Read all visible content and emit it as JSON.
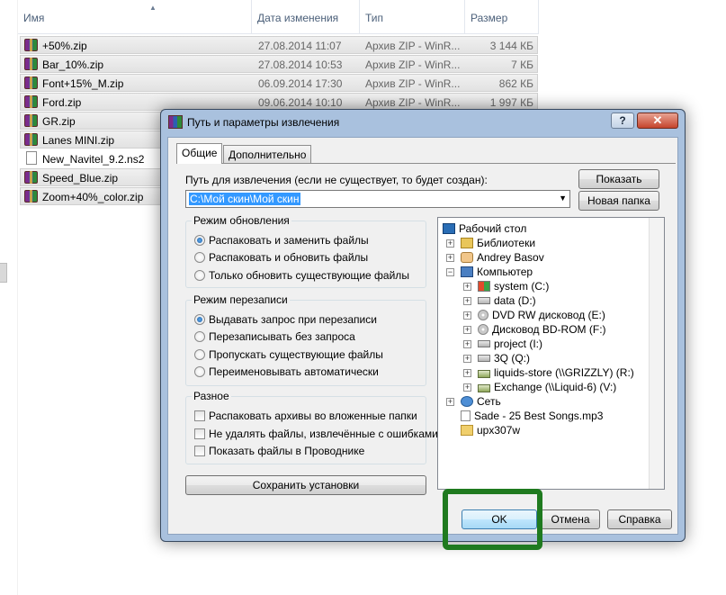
{
  "explorer": {
    "columns": {
      "name": "Имя",
      "date": "Дата изменения",
      "type": "Тип",
      "size": "Размер"
    },
    "files": [
      {
        "name": "+50%.zip",
        "date": "27.08.2014 11:07",
        "type": "Архив ZIP - WinR...",
        "size": "3 144 КБ",
        "icon": "rar-archive-icon",
        "selected": true
      },
      {
        "name": "Bar_10%.zip",
        "date": "27.08.2014 10:53",
        "type": "Архив ZIP - WinR...",
        "size": "7 КБ",
        "icon": "rar-archive-icon",
        "selected": true
      },
      {
        "name": "Font+15%_M.zip",
        "date": "06.09.2014 17:30",
        "type": "Архив ZIP - WinR...",
        "size": "862 КБ",
        "icon": "rar-archive-icon",
        "selected": true
      },
      {
        "name": "Ford.zip",
        "date": "09.06.2014 10:10",
        "type": "Архив ZIP - WinR...",
        "size": "1 997 КБ",
        "icon": "rar-archive-icon",
        "selected": true
      },
      {
        "name": "GR.zip",
        "date": "",
        "type": "",
        "size": "",
        "icon": "rar-archive-icon",
        "selected": true
      },
      {
        "name": "Lanes MINI.zip",
        "date": "",
        "type": "",
        "size": "",
        "icon": "rar-archive-icon",
        "selected": true
      },
      {
        "name": "New_Navitel_9.2.ns2",
        "date": "",
        "type": "",
        "size": "",
        "icon": "document-icon",
        "selected": false
      },
      {
        "name": "Speed_Blue.zip",
        "date": "",
        "type": "",
        "size": "",
        "icon": "rar-archive-icon",
        "selected": true
      },
      {
        "name": "Zoom+40%_color.zip",
        "date": "",
        "type": "",
        "size": "",
        "icon": "rar-archive-icon",
        "selected": true
      }
    ]
  },
  "dialog": {
    "title": "Путь и параметры извлечения",
    "help_label": "?",
    "close_label": "✕",
    "tabs": [
      "Общие",
      "Дополнительно"
    ],
    "path_label": "Путь для извлечения (если не существует, то будет создан):",
    "path_value": "C:\\Мой скин\\Мой скин",
    "show_button": "Показать",
    "new_folder_button": "Новая папка",
    "update_mode": {
      "title": "Режим обновления",
      "options": [
        "Распаковать и заменить файлы",
        "Распаковать и обновить файлы",
        "Только обновить существующие файлы"
      ],
      "selected": 0
    },
    "overwrite_mode": {
      "title": "Режим перезаписи",
      "options": [
        "Выдавать запрос при перезаписи",
        "Перезаписывать без запроса",
        "Пропускать существующие файлы",
        "Переименовывать автоматически"
      ],
      "selected": 0
    },
    "misc": {
      "title": "Разное",
      "options": [
        "Распаковать архивы во вложенные папки",
        "Не удалять файлы, извлечённые с ошибками",
        "Показать файлы в Проводнике"
      ]
    },
    "save_button": "Сохранить установки",
    "tree": [
      {
        "label": "Рабочий стол",
        "icon": "desktop-icon",
        "level": 0,
        "expander": ""
      },
      {
        "label": "Библиотеки",
        "icon": "libraries-icon",
        "level": 1,
        "expander": "+"
      },
      {
        "label": "Andrey Basov",
        "icon": "user-folder-icon",
        "level": 1,
        "expander": "+"
      },
      {
        "label": "Компьютер",
        "icon": "computer-icon",
        "level": 1,
        "expander": "−"
      },
      {
        "label": "system (C:)",
        "icon": "system-drive-icon",
        "level": 2,
        "expander": "+"
      },
      {
        "label": "data (D:)",
        "icon": "hard-drive-icon",
        "level": 2,
        "expander": "+"
      },
      {
        "label": "DVD RW дисковод (E:)",
        "icon": "dvd-drive-icon",
        "level": 2,
        "expander": "+"
      },
      {
        "label": "Дисковод BD-ROM (F:)",
        "icon": "bd-drive-icon",
        "level": 2,
        "expander": "+"
      },
      {
        "label": "project (I:)",
        "icon": "hard-drive-icon",
        "level": 2,
        "expander": "+"
      },
      {
        "label": "3Q (Q:)",
        "icon": "hard-drive-icon",
        "level": 2,
        "expander": "+"
      },
      {
        "label": "liquids-store (\\\\GRIZZLY) (R:)",
        "icon": "network-drive-icon",
        "level": 2,
        "expander": "+"
      },
      {
        "label": "Exchange (\\\\Liquid-6) (V:)",
        "icon": "network-drive-icon",
        "level": 2,
        "expander": "+"
      },
      {
        "label": "Сеть",
        "icon": "network-icon",
        "level": 1,
        "expander": "+"
      },
      {
        "label": "Sade - 25 Best Songs.mp3",
        "icon": "audio-file-icon",
        "level": 1,
        "expander": ""
      },
      {
        "label": "upx307w",
        "icon": "folder-icon",
        "level": 1,
        "expander": ""
      }
    ],
    "ok_button": "OK",
    "cancel_button": "Отмена",
    "help_button": "Справка"
  },
  "colors": {
    "highlight": "#1f7a1f",
    "selection": "#3399ff",
    "close": "#c5442c"
  }
}
